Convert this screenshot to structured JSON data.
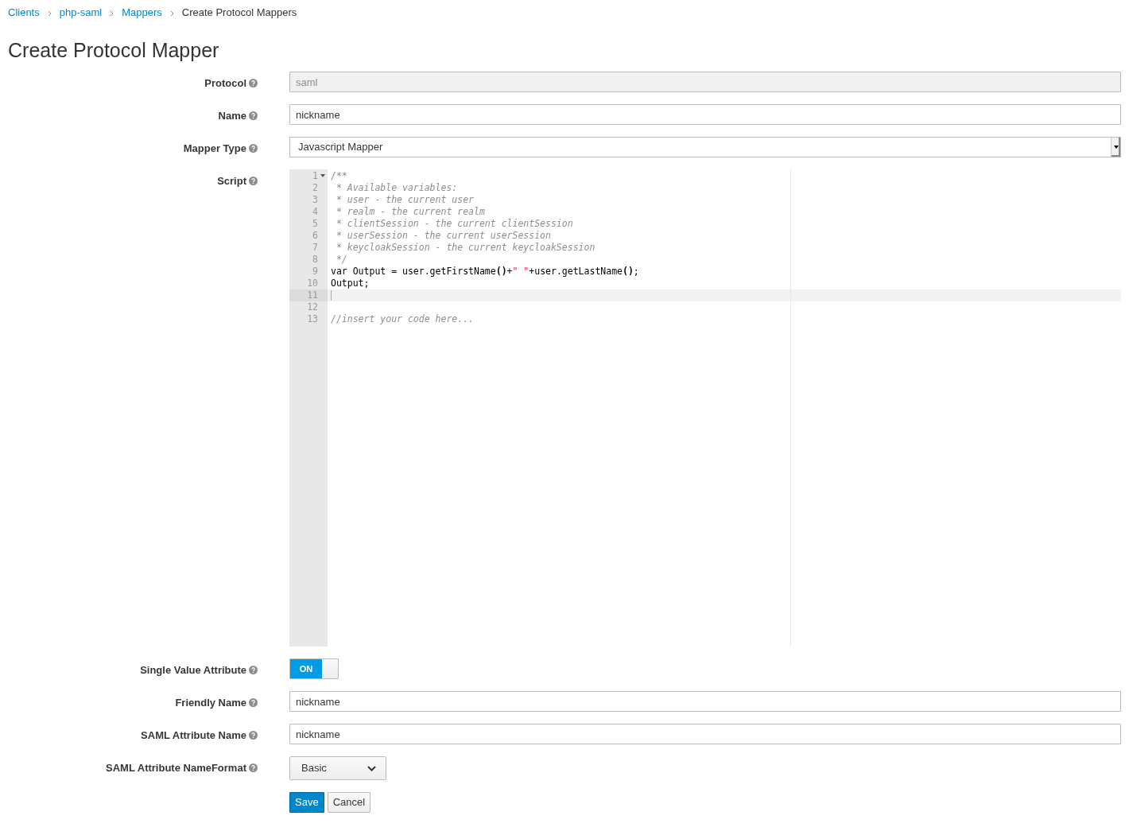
{
  "breadcrumb": [
    {
      "label": "Clients",
      "kind": "link"
    },
    {
      "label": "php-saml",
      "kind": "link"
    },
    {
      "label": "Mappers",
      "kind": "link"
    },
    {
      "label": "Create Protocol Mappers",
      "kind": "current"
    }
  ],
  "title": "Create Protocol Mapper",
  "fields": [
    {
      "kind": "text",
      "label": "Protocol",
      "value": "saml",
      "disabled": true
    },
    {
      "kind": "text",
      "label": "Name",
      "value": "nickname",
      "disabled": false
    },
    {
      "kind": "select",
      "label": "Mapper Type",
      "value": "Javascript Mapper"
    },
    {
      "kind": "script",
      "label": "Script",
      "lines": [
        {
          "number": "1",
          "foldable": true,
          "current": false,
          "tokens": [
            {
              "kind": "comment",
              "text": "/**"
            }
          ]
        },
        {
          "number": "2",
          "foldable": false,
          "current": false,
          "tokens": [
            {
              "kind": "comment",
              "text": " * Available variables:"
            }
          ]
        },
        {
          "number": "3",
          "foldable": false,
          "current": false,
          "tokens": [
            {
              "kind": "comment",
              "text": " * user - the current user"
            }
          ]
        },
        {
          "number": "4",
          "foldable": false,
          "current": false,
          "tokens": [
            {
              "kind": "comment",
              "text": " * realm - the current realm"
            }
          ]
        },
        {
          "number": "5",
          "foldable": false,
          "current": false,
          "tokens": [
            {
              "kind": "comment",
              "text": " * clientSession - the current clientSession"
            }
          ]
        },
        {
          "number": "6",
          "foldable": false,
          "current": false,
          "tokens": [
            {
              "kind": "comment",
              "text": " * userSession - the current userSession"
            }
          ]
        },
        {
          "number": "7",
          "foldable": false,
          "current": false,
          "tokens": [
            {
              "kind": "comment",
              "text": " * keycloakSession - the current keycloakSession"
            }
          ]
        },
        {
          "number": "8",
          "foldable": false,
          "current": false,
          "tokens": [
            {
              "kind": "comment",
              "text": " */"
            }
          ]
        },
        {
          "number": "9",
          "foldable": false,
          "current": false,
          "tokens": [
            {
              "kind": "plain",
              "text": "var Output = user.getFirstName"
            },
            {
              "kind": "paren",
              "text": "()"
            },
            {
              "kind": "plain",
              "text": "+"
            },
            {
              "kind": "string",
              "text": "\" \""
            },
            {
              "kind": "plain",
              "text": "+user.getLastName"
            },
            {
              "kind": "paren",
              "text": "()"
            },
            {
              "kind": "plain",
              "text": ";"
            }
          ]
        },
        {
          "number": "10",
          "foldable": false,
          "current": false,
          "tokens": [
            {
              "kind": "plain",
              "text": "Output;"
            }
          ]
        },
        {
          "number": "11",
          "foldable": false,
          "current": true
        },
        {
          "number": "12",
          "foldable": false,
          "current": false
        },
        {
          "number": "13",
          "foldable": false,
          "current": false,
          "tokens": [
            {
              "kind": "comment",
              "text": "//insert your code here..."
            }
          ]
        }
      ]
    },
    {
      "kind": "toggle",
      "label": "Single Value Attribute",
      "on": true,
      "on_text": "ON"
    },
    {
      "kind": "text",
      "label": "Friendly Name",
      "value": "nickname",
      "disabled": false
    },
    {
      "kind": "text",
      "label": "SAML Attribute Name",
      "value": "nickname",
      "disabled": false
    },
    {
      "kind": "dropdown",
      "label": "SAML Attribute NameFormat",
      "value": "Basic"
    }
  ],
  "buttons": [
    {
      "label": "Save",
      "kind": "primary"
    },
    {
      "label": "Cancel",
      "kind": "default"
    }
  ]
}
